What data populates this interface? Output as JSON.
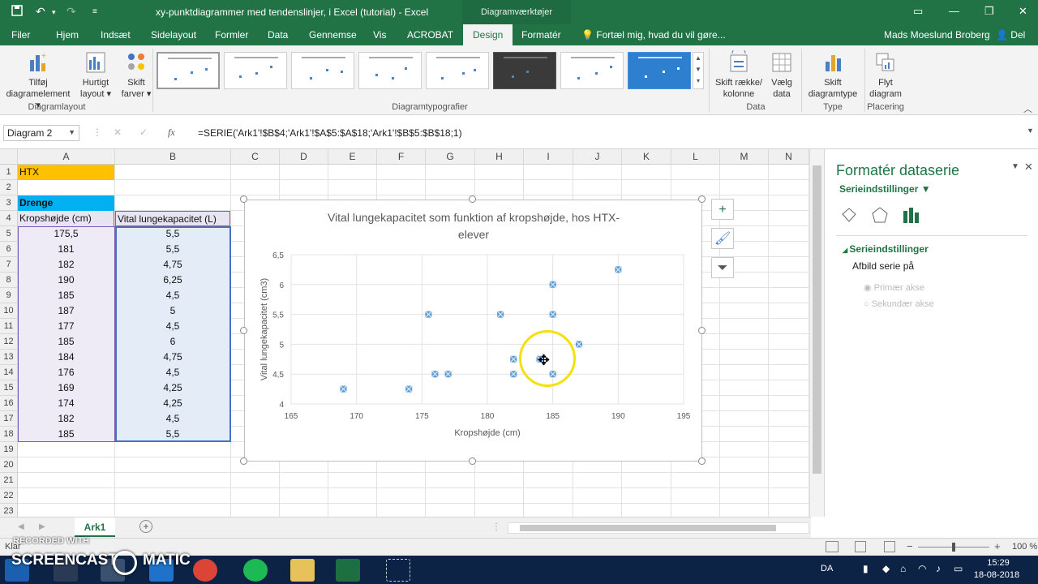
{
  "titlebar": {
    "doc_title": "xy-punktdiagrammer med tendenslinjer, i Excel (tutorial) - Excel",
    "context_title": "Diagramværktøjer"
  },
  "tabs": [
    "Filer",
    "Hjem",
    "Indsæt",
    "Sidelayout",
    "Formler",
    "Data",
    "Gennemse",
    "Vis",
    "ACROBAT",
    "Design",
    "Formatér"
  ],
  "active_tab": "Design",
  "tellme": "Fortæl mig, hvad du vil gøre...",
  "user": "Mads Moeslund Broberg",
  "share": "Del",
  "ribbon": {
    "add_element": [
      "Tilføj",
      "diagramelement ▾"
    ],
    "quick_layout": [
      "Hurtigt",
      "layout ▾"
    ],
    "change_colors": [
      "Skift",
      "farver ▾"
    ],
    "group_layouts": "Diagramlayout",
    "group_styles": "Diagramtypografier",
    "switch_rowcol": [
      "Skift række/",
      "kolonne"
    ],
    "select_data": [
      "Vælg",
      "data"
    ],
    "group_data": "Data",
    "change_type": [
      "Skift",
      "diagramtype"
    ],
    "group_type": "Type",
    "move_chart": [
      "Flyt",
      "diagram"
    ],
    "group_location": "Placering"
  },
  "formula": {
    "namebox": "Diagram 2",
    "fx": "fx",
    "text": "=SERIE('Ark1'!$B$4;'Ark1'!$A$5:$A$18;'Ark1'!$B$5:$B$18;1)"
  },
  "columns": [
    "A",
    "B",
    "C",
    "D",
    "E",
    "F",
    "G",
    "H",
    "I",
    "J",
    "K",
    "L",
    "M",
    "N"
  ],
  "rows": [
    "1",
    "2",
    "3",
    "4",
    "5",
    "6",
    "7",
    "8",
    "9",
    "10",
    "11",
    "12",
    "13",
    "14",
    "15",
    "16",
    "17",
    "18",
    "19",
    "20",
    "21",
    "22",
    "23"
  ],
  "cells": {
    "a1": "HTX",
    "a3": "Drenge",
    "a4": "Kropshøjde (cm)",
    "b4": "Vital lungekapacitet (L)"
  },
  "table": [
    [
      "175,5",
      "5,5"
    ],
    [
      "181",
      "5,5"
    ],
    [
      "182",
      "4,75"
    ],
    [
      "190",
      "6,25"
    ],
    [
      "185",
      "4,5"
    ],
    [
      "187",
      "5"
    ],
    [
      "177",
      "4,5"
    ],
    [
      "185",
      "6"
    ],
    [
      "184",
      "4,75"
    ],
    [
      "176",
      "4,5"
    ],
    [
      "169",
      "4,25"
    ],
    [
      "174",
      "4,25"
    ],
    [
      "182",
      "4,5"
    ],
    [
      "185",
      "5,5"
    ]
  ],
  "chart_data": {
    "type": "scatter",
    "title": "Vital lungekapacitet som funktion af kropshøjde, hos HTX-elever",
    "title_lines": [
      "Vital lungekapacitet som funktion af kropshøjde, hos HTX-",
      "elever"
    ],
    "xlabel": "Kropshøjde (cm)",
    "ylabel": "Vital lungekapacitet (cm3)",
    "xlim": [
      165,
      195
    ],
    "ylim": [
      4,
      6.5
    ],
    "xticks": [
      "165",
      "170",
      "175",
      "180",
      "185",
      "190",
      "195"
    ],
    "yticks": [
      "4",
      "4,5",
      "5",
      "5,5",
      "6",
      "6,5"
    ],
    "grid": true,
    "series": [
      {
        "name": "Vital lungekapacitet (L)",
        "color": "#5b9bd5",
        "points": [
          [
            175.5,
            5.5
          ],
          [
            181,
            5.5
          ],
          [
            182,
            4.75
          ],
          [
            190,
            6.25
          ],
          [
            185,
            4.5
          ],
          [
            187,
            5
          ],
          [
            177,
            4.5
          ],
          [
            185,
            6
          ],
          [
            184,
            4.75
          ],
          [
            176,
            4.5
          ],
          [
            169,
            4.25
          ],
          [
            174,
            4.25
          ],
          [
            182,
            4.5
          ],
          [
            185,
            5.5
          ]
        ]
      }
    ]
  },
  "pane": {
    "title": "Formatér dataserie",
    "subtitle": "Serieindstillinger",
    "section": "Serieindstillinger",
    "plot_on": "Afbild serie på",
    "primary": "Primær akse",
    "secondary": "Sekundær akse"
  },
  "sheet_tab": "Ark1",
  "status": {
    "ready": "Klar",
    "zoom": "100 %"
  },
  "taskbar": {
    "lang": "DA",
    "time": "15:29",
    "date": "18-08-2018"
  },
  "watermark": {
    "line1": "RECORDED WITH",
    "line2": "SCREENCAST",
    "line3": "MATIC"
  },
  "colors": {
    "excel_green": "#217346",
    "highlight_yellow": "#ffc000",
    "highlight_blue": "#00b0f0",
    "marker": "#5b9bd5"
  }
}
